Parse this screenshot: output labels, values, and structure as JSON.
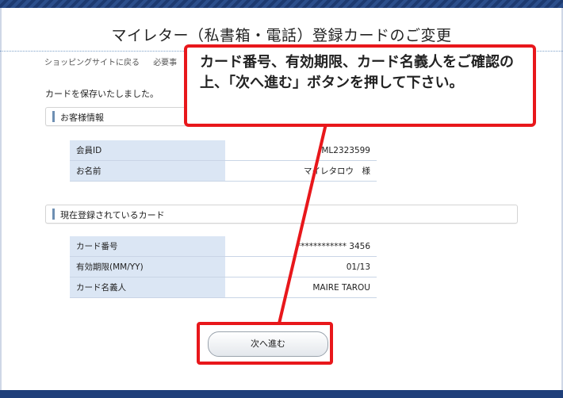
{
  "page": {
    "title": "マイレター（私書箱・電話）登録カードのご変更",
    "subnav": [
      "ショッピングサイトに戻る",
      "必要事"
    ],
    "save_message": "カードを保存いたしました。"
  },
  "customer_section": {
    "header": "お客様情報",
    "rows": [
      {
        "label": "会員ID",
        "value": "ML2323599"
      },
      {
        "label": "お名前",
        "value": "マイレタロウ　様"
      }
    ]
  },
  "card_section": {
    "header": "現在登録されているカード",
    "rows": [
      {
        "label": "カード番号",
        "value": "************ 3456"
      },
      {
        "label": "有効期限(MM/YY)",
        "value": "01/13"
      },
      {
        "label": "カード名義人",
        "value": "MAIRE TAROU"
      }
    ]
  },
  "next_button": {
    "label": "次へ進む"
  },
  "annotation": {
    "text": "カード番号、有効期限、カード名義人をご確認の上、「次へ進む」ボタンを押して下さい。",
    "color": "#e8171b"
  }
}
